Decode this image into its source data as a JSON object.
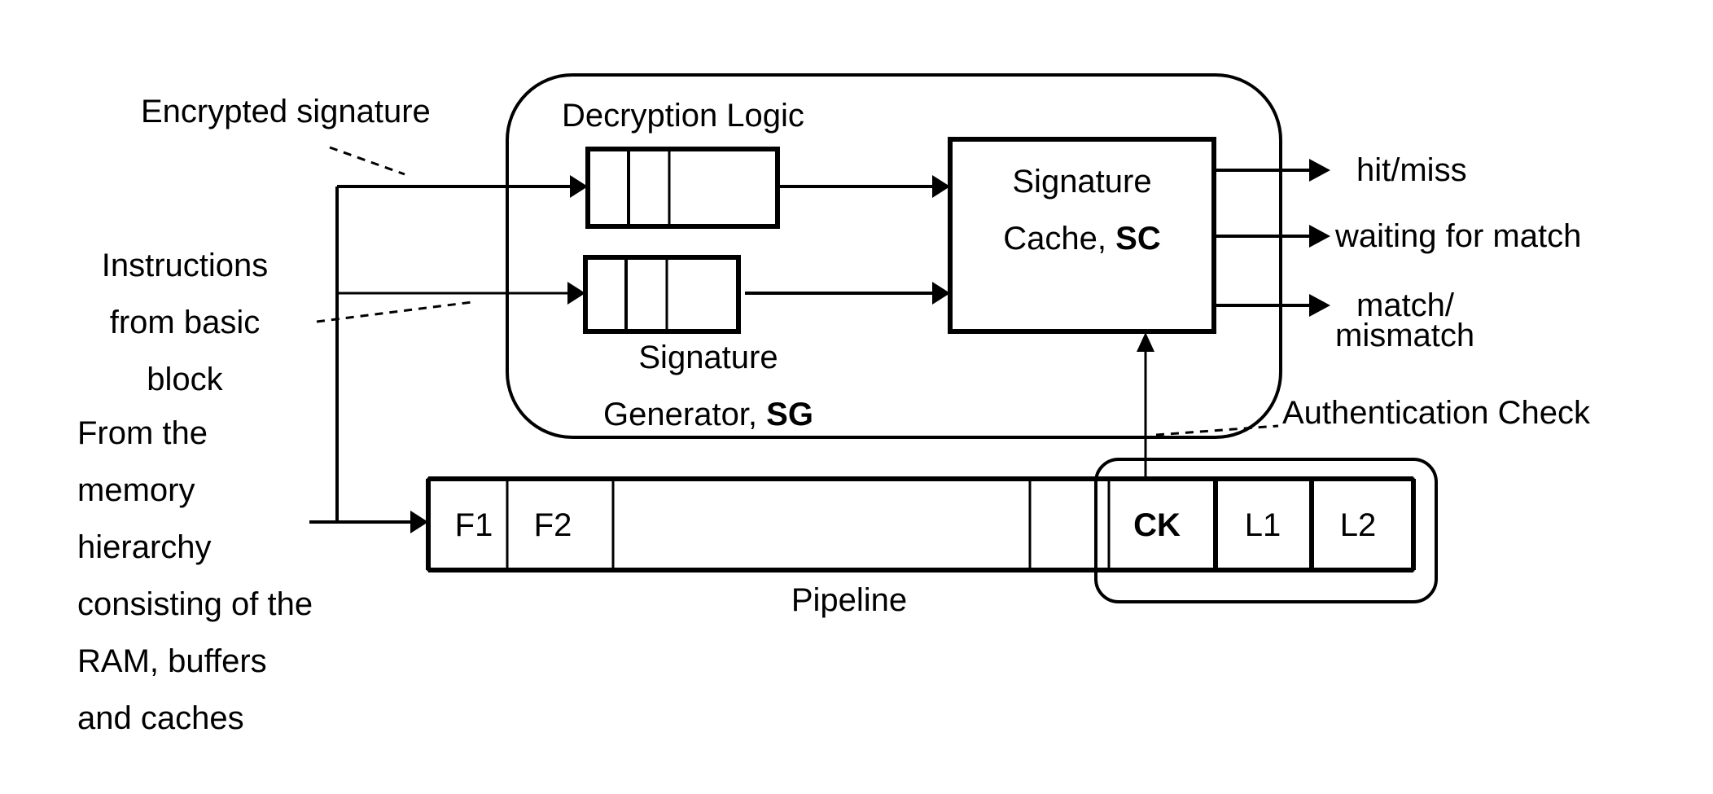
{
  "diagram": {
    "labels": {
      "encrypted_signature": "Encrypted signature",
      "instructions_line1": "Instructions",
      "instructions_line2": "from basic",
      "instructions_line3": "block",
      "memory_lines": [
        "From the",
        "memory",
        "hierarchy",
        "consisting of the",
        "RAM, buffers",
        "and caches"
      ],
      "decryption_logic": "Decryption Logic",
      "sig_gen_line1": "Signature",
      "sig_gen_line2_prefix": "Generator, ",
      "sig_gen_line2_bold": "SG",
      "sig_cache_line1": "Signature",
      "sig_cache_line2_prefix": "Cache, ",
      "sig_cache_line2_bold": "SC",
      "authentication_check": "Authentication Check",
      "pipeline": "Pipeline"
    },
    "outputs": {
      "hit_miss": "hit/miss",
      "waiting": "waiting for match",
      "match_line1": "match/",
      "match_line2": "mismatch"
    },
    "pipeline_stages": {
      "f1": "F1",
      "f2": "F2",
      "ck": "CK",
      "l1": "L1",
      "l2": "L2"
    }
  }
}
